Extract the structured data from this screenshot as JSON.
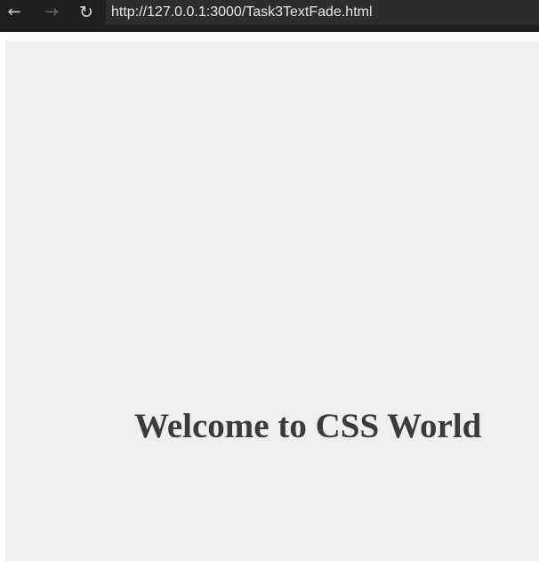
{
  "browser": {
    "url": "http://127.0.0.1:3000/Task3TextFade.html",
    "nav": {
      "back_icon": "←",
      "forward_icon": "→",
      "reload_icon": "↻"
    }
  },
  "page": {
    "heading": "Welcome to CSS World",
    "background_color": "#efefef",
    "text_color": "#3b3b3b"
  }
}
